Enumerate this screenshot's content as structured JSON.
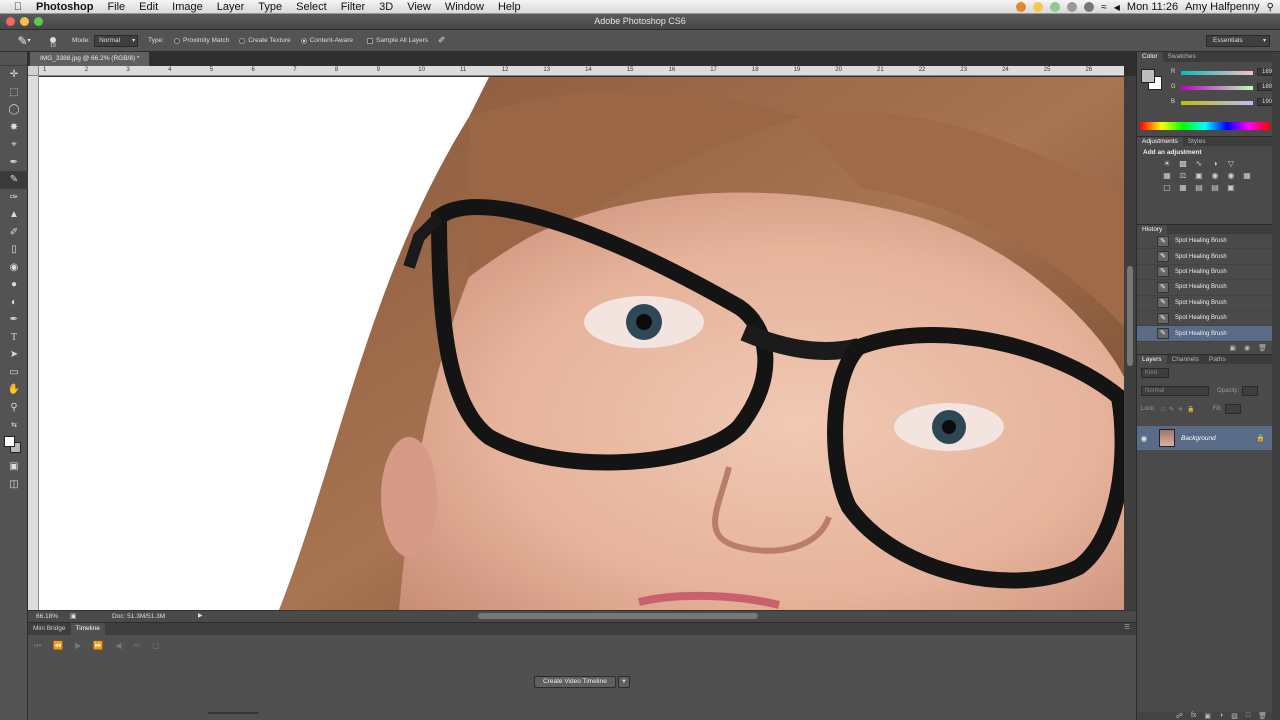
{
  "menubar": {
    "app": "Photoshop",
    "items": [
      "File",
      "Edit",
      "Image",
      "Layer",
      "Type",
      "Select",
      "Filter",
      "3D",
      "View",
      "Window",
      "Help"
    ],
    "clock": "Mon 11:26",
    "user": "Amy Halfpenny"
  },
  "window": {
    "title": "Adobe Photoshop CS6"
  },
  "options": {
    "mode_label": "Mode:",
    "mode_value": "Normal",
    "type_label": "Type:",
    "proximity": "Proximity Match",
    "create_texture": "Create Texture",
    "content_aware": "Content-Aware",
    "sample_all": "Sample All Layers",
    "workspace": "Essentials"
  },
  "document": {
    "tab": "IMG_3388.jpg @ 66.2% (RGB/8) *",
    "ruler_ticks": [
      "1",
      "2",
      "3",
      "4",
      "5",
      "6",
      "7",
      "8",
      "9",
      "10",
      "11",
      "12",
      "13",
      "14",
      "15",
      "16",
      "17",
      "18",
      "19",
      "20",
      "21",
      "22",
      "23",
      "24",
      "25",
      "26"
    ],
    "zoom": "66.18%",
    "doc_size": "Doc: 51.3M/51.3M"
  },
  "bottom_panel": {
    "tabs": [
      "Mini Bridge",
      "Timeline"
    ],
    "create_button": "Create Video Timeline"
  },
  "color_panel": {
    "tabs": [
      "Color",
      "Swatches"
    ],
    "channels": [
      {
        "name": "R",
        "value": "189"
      },
      {
        "name": "G",
        "value": "189"
      },
      {
        "name": "B",
        "value": "190"
      }
    ],
    "foreground": "#bcbcbe"
  },
  "adjustments": {
    "tabs": [
      "Adjustments",
      "Styles"
    ],
    "title": "Add an adjustment"
  },
  "history": {
    "tab": "History",
    "items": [
      "Spot Healing Brush",
      "Spot Healing Brush",
      "Spot Healing Brush",
      "Spot Healing Brush",
      "Spot Healing Brush",
      "Spot Healing Brush",
      "Spot Healing Brush"
    ]
  },
  "layers": {
    "tabs": [
      "Layers",
      "Channels",
      "Paths"
    ],
    "kind": "Kind",
    "blend": "Normal",
    "opacity_label": "Opacity:",
    "lock_label": "Lock:",
    "fill_label": "Fill:",
    "layer_name": "Background"
  },
  "colors": {
    "selection": "#5a6b87",
    "panel_bg": "#4a4a4a",
    "chrome": "#535353"
  }
}
